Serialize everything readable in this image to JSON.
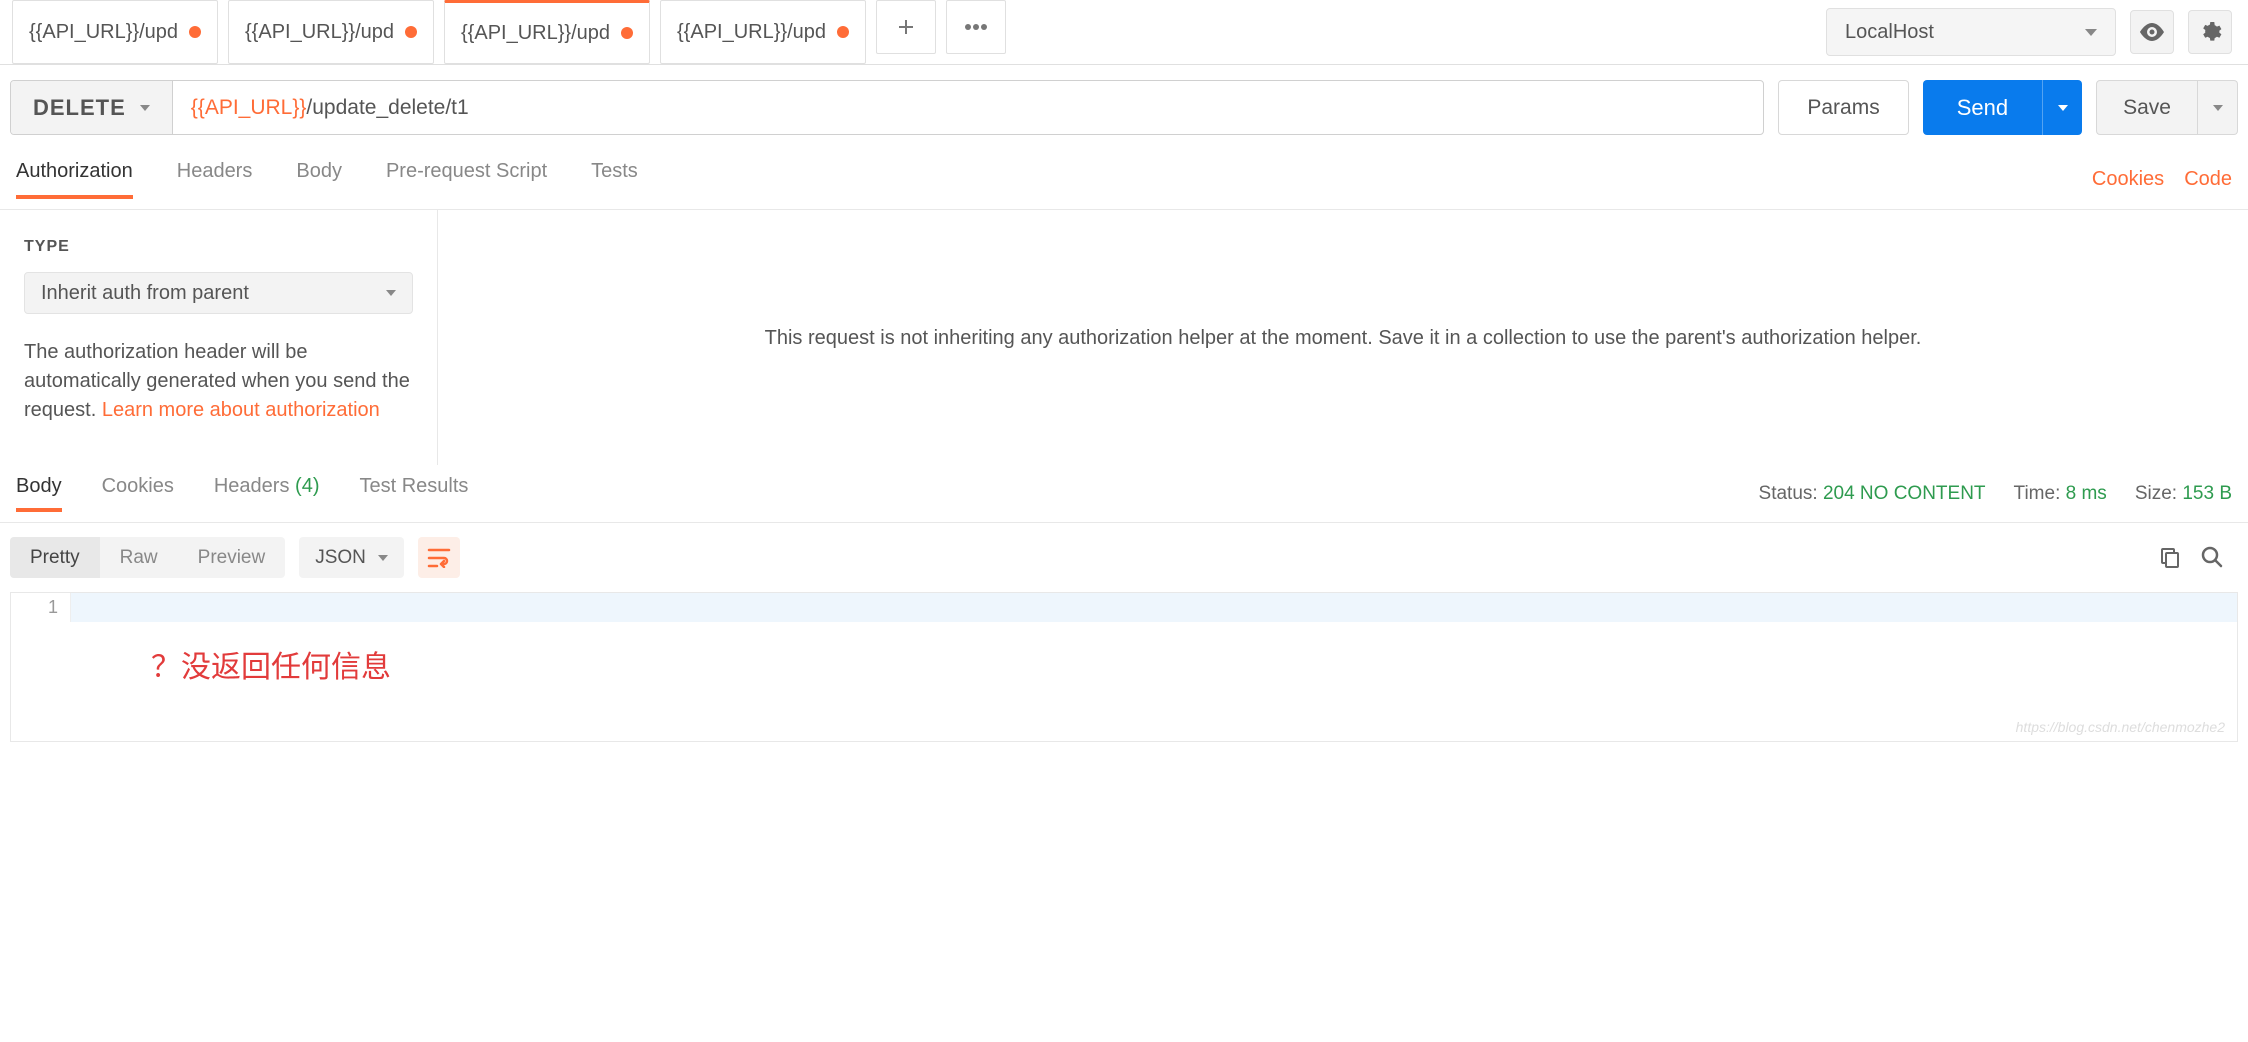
{
  "tabs": [
    {
      "label": "{{API_URL}}/update_d",
      "dirty": true,
      "active": false
    },
    {
      "label": "{{API_URL}}/update_d",
      "dirty": true,
      "active": false
    },
    {
      "label": "{{API_URL}}/update_d",
      "dirty": true,
      "active": true
    },
    {
      "label": "{{API_URL}}/update_d",
      "dirty": true,
      "active": false
    }
  ],
  "environment": {
    "selected": "LocalHost"
  },
  "request": {
    "method": "DELETE",
    "url_var": "{{API_URL}}",
    "url_rest": "/update_delete/t1",
    "params_label": "Params",
    "send_label": "Send",
    "save_label": "Save"
  },
  "sub_tabs": {
    "items": [
      "Authorization",
      "Headers",
      "Body",
      "Pre-request Script",
      "Tests"
    ],
    "active": "Authorization",
    "cookies_link": "Cookies",
    "code_link": "Code"
  },
  "auth": {
    "type_label": "TYPE",
    "type_selected": "Inherit auth from parent",
    "desc_prefix": "The authorization header will be automatically generated when you send the request. ",
    "desc_link": "Learn more about authorization",
    "right_msg": "This request is not inheriting any authorization helper at the moment. Save it in a collection to use the parent's authorization helper."
  },
  "response": {
    "tabs": [
      "Body",
      "Cookies",
      "Headers",
      "Test Results"
    ],
    "active": "Body",
    "headers_count": "(4)",
    "status_label": "Status:",
    "status_value": "204 NO CONTENT",
    "time_label": "Time:",
    "time_value": "8 ms",
    "size_label": "Size:",
    "size_value": "153 B"
  },
  "body_view": {
    "modes": [
      "Pretty",
      "Raw",
      "Preview"
    ],
    "active_mode": "Pretty",
    "format": "JSON",
    "line_number": "1",
    "annotation": "？没返回任何信息"
  },
  "watermark": "https://blog.csdn.net/chenmozhe2"
}
